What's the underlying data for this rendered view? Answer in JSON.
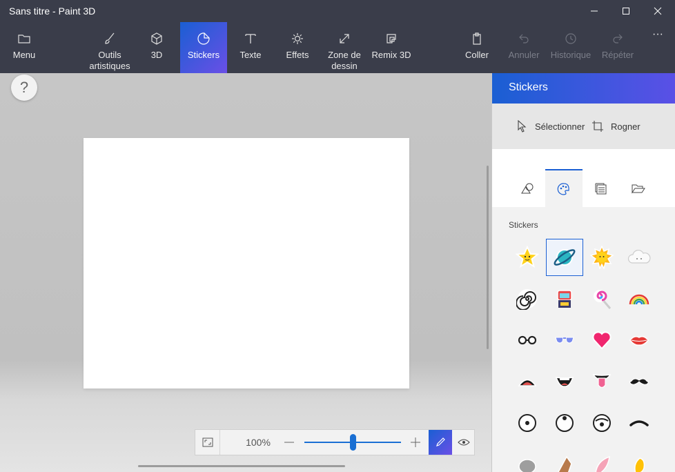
{
  "window": {
    "title": "Sans titre - Paint 3D"
  },
  "toolbar": {
    "menu": "Menu",
    "brushes": "Outils artistiques",
    "three_d": "3D",
    "stickers": "Stickers",
    "text": "Texte",
    "effects": "Effets",
    "canvas": "Zone de dessin",
    "remix": "Remix 3D",
    "paste": "Coller",
    "undo": "Annuler",
    "history": "Historique",
    "redo": "Répéter",
    "more": "···"
  },
  "help": {
    "label": "?"
  },
  "zoom": {
    "value": "100%",
    "level": 0.5
  },
  "panel": {
    "title": "Stickers",
    "select_label": "Sélectionner",
    "crop_label": "Rogner",
    "section_label": "Stickers"
  },
  "stickers": [
    "star",
    "planet",
    "sun",
    "cloud",
    "spiral",
    "robot",
    "lollipop",
    "rainbow",
    "glasses",
    "sunglasses",
    "heart",
    "lips",
    "mouth-open",
    "mouth-teeth",
    "mouth-tongue",
    "mustache",
    "eye-center",
    "eye-up",
    "eye-down",
    "eyelid",
    "nose-grey",
    "ear-brown",
    "ear-pink",
    "ear-yellow"
  ],
  "colors": {
    "accent": "#1a5fd3",
    "accent2": "#6a4fe6",
    "chrome": "#3a3d4a"
  }
}
